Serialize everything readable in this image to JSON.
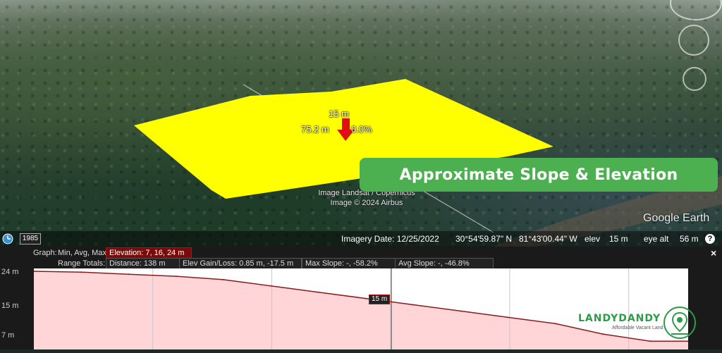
{
  "banner": {
    "text": "Approximate Slope & Elevation"
  },
  "plot": {
    "elevation_label": "15 m",
    "distance_label": "75.2 m",
    "slope_label": "0.0%",
    "fill_color": "#ffff00",
    "arrow_color": "#e01010"
  },
  "attribution": {
    "line1": "Image Landsat / Copernicus",
    "line2": "Image © 2024 Airbus"
  },
  "google_earth": "Google Earth",
  "statusbar": {
    "year": "1985",
    "imagery_date": "Imagery Date: 12/25/2022",
    "lat": "30°54'59.87\" N",
    "lon": "81°43'00.44\" W",
    "elev_label": "elev",
    "elev_value": "15 m",
    "eye_alt_label": "eye alt",
    "eye_alt_value": "56 m",
    "help": "?"
  },
  "profile": {
    "graph_label": "Graph:",
    "graph_modes": "Min, Avg, Max",
    "elevation": "Elevation: 7, 16, 24 m",
    "range_totals_label": "Range Totals:",
    "distance": "Distance: 138 m",
    "elev_gain_loss": "Elev Gain/Loss: 0.85 m, -17.5 m",
    "max_slope": "Max Slope: -, -58.2%",
    "avg_slope": "Avg Slope: -, -46.8%",
    "close": "×",
    "y_ticks": [
      "24 m",
      "15 m",
      "7 m"
    ],
    "marker_label": "15 m"
  },
  "chart_data": {
    "type": "area",
    "xlabel": "",
    "ylabel": "",
    "x": [
      0,
      10,
      20,
      30,
      40,
      50,
      60,
      70,
      80,
      90,
      100,
      110,
      120,
      130,
      138
    ],
    "y": [
      24,
      23.8,
      23.3,
      22.8,
      22,
      20.5,
      19,
      17.5,
      16,
      14.5,
      13,
      11.5,
      9,
      7.3,
      7.3
    ],
    "ylim": [
      7,
      24
    ],
    "y_ticks": [
      "24 m",
      "15 m",
      "7 m"
    ],
    "line_color": "#8b1a1a",
    "fill_color": "#ffd5d8",
    "grid": true
  },
  "logo": {
    "name": "LANDYDANDY",
    "tagline": "Affordable Vacant Land",
    "color": "#2e9b4a"
  }
}
